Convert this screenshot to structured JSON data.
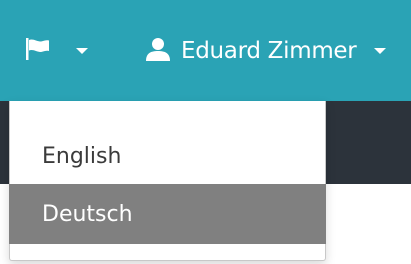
{
  "navbar": {
    "language_menu": {
      "icon": "flag-icon"
    },
    "user_menu": {
      "icon": "user-icon",
      "name": "Eduard Zimmer"
    }
  },
  "language_dropdown": {
    "items": [
      {
        "label": "English",
        "highlighted": false
      },
      {
        "label": "Deutsch",
        "highlighted": true
      }
    ]
  },
  "colors": {
    "navbar": "#2aa3b5",
    "subbar": "#2c333b",
    "highlight": "#808080"
  }
}
